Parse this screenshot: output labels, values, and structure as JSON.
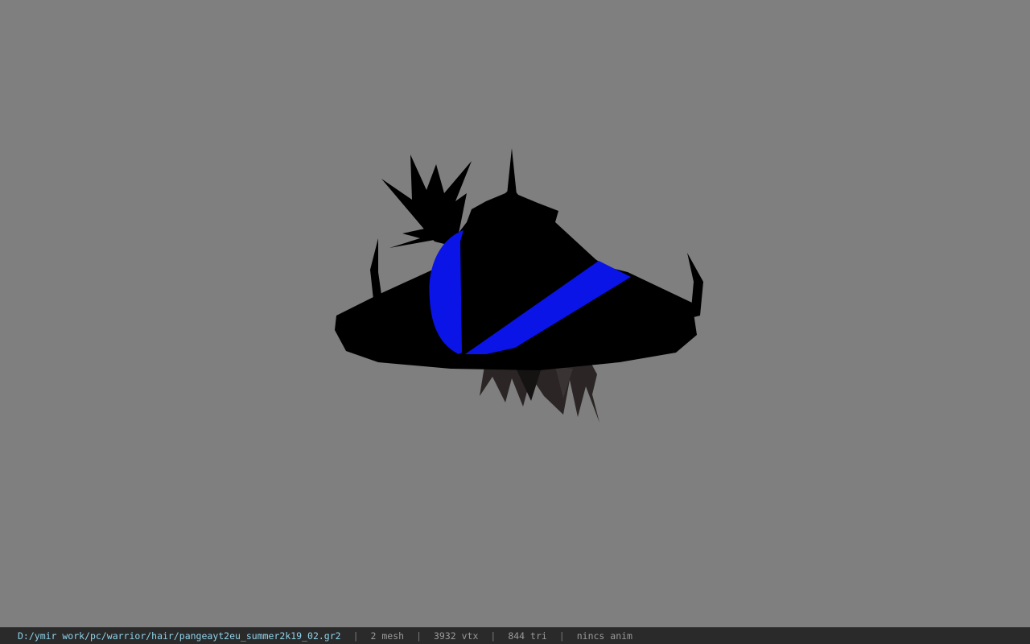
{
  "viewport": {
    "background_color": "#7f7f7f",
    "model": {
      "primary_color": "#000000",
      "band_color": "#0a14e6",
      "hair_color": "#2a2424"
    }
  },
  "statusbar": {
    "file_path": "D:/ymir work/pc/warrior/hair/pangeayt2eu_summer2k19_02.gr2",
    "separator": "|",
    "mesh_count": "2 mesh",
    "vertex_count": "3932 vtx",
    "triangle_count": "844 tri",
    "animation": "nincs anim",
    "path_color": "#8fd3ea",
    "background_color": "#2a2a2a"
  }
}
